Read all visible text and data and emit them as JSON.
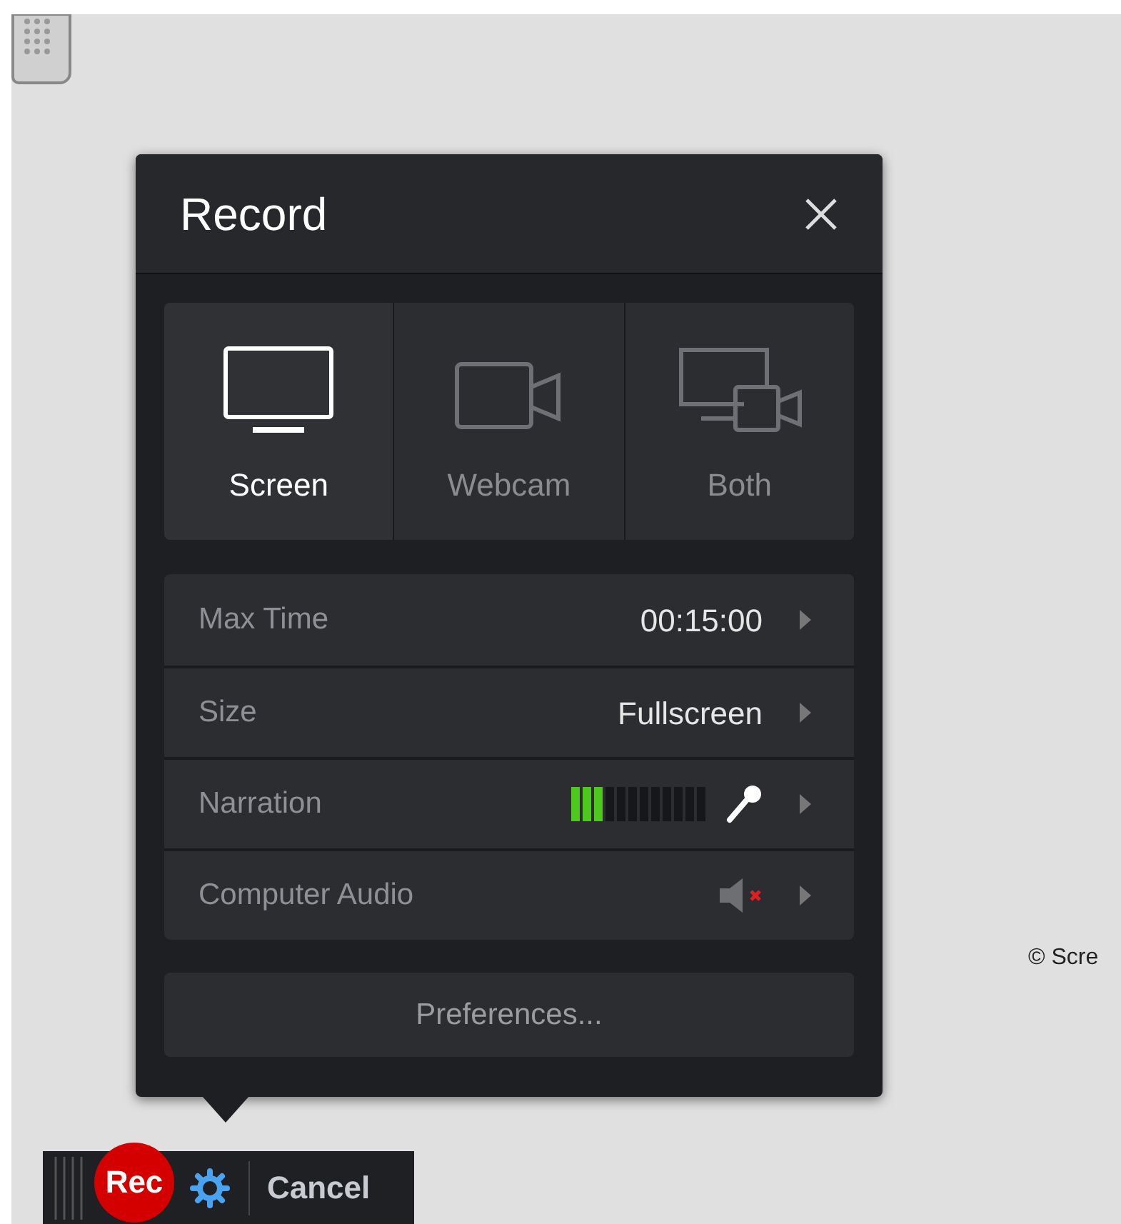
{
  "dialog": {
    "title": "Record",
    "modes": [
      {
        "label": "Screen",
        "kind": "screen",
        "selected": true
      },
      {
        "label": "Webcam",
        "kind": "webcam",
        "selected": false
      },
      {
        "label": "Both",
        "kind": "both",
        "selected": false
      }
    ],
    "settings": [
      {
        "kind": "text",
        "label": "Max Time",
        "value": "00:15:00"
      },
      {
        "kind": "text",
        "label": "Size",
        "value": "Fullscreen"
      },
      {
        "kind": "meter",
        "label": "Narration",
        "level": 0.25
      },
      {
        "kind": "audio",
        "label": "Computer Audio",
        "muted": true
      }
    ],
    "preferences_button": "Preferences..."
  },
  "toolbar": {
    "record_button": "Rec",
    "cancel_button": "Cancel"
  },
  "footer_text": "© Scre"
}
